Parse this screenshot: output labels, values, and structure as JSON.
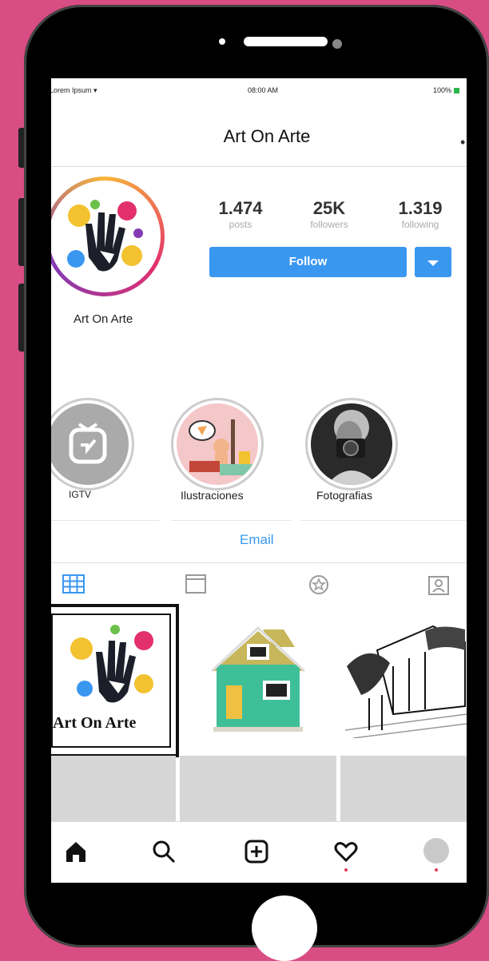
{
  "status_bar": {
    "carrier": "Lorem Ipsum",
    "time": "08:00 AM",
    "battery": "100%"
  },
  "header": {
    "title": "Art On Arte",
    "more_icon": "more-dots-icon"
  },
  "profile": {
    "name": "Art On Arte",
    "stats": [
      {
        "value": "1.474",
        "label": "posts"
      },
      {
        "value": "25K",
        "label": "followers"
      },
      {
        "value": "1.319",
        "label": "following"
      }
    ],
    "follow_label": "Follow"
  },
  "highlights": [
    {
      "label": "IGTV",
      "icon": "igtv-icon"
    },
    {
      "label": "Ilustraciones",
      "icon": "illustration-thumbnail"
    },
    {
      "label": "Fotografias",
      "icon": "photo-thumbnail"
    }
  ],
  "contact": {
    "email_label": "Email"
  },
  "tabs": [
    "grid-icon",
    "igtv-tab-icon",
    "tagged-star-icon",
    "person-tag-icon"
  ],
  "posts": [
    {
      "caption": "Art On Arte"
    },
    {
      "caption": ""
    },
    {
      "caption": ""
    }
  ],
  "bottom_nav": [
    "home-icon",
    "search-icon",
    "add-post-icon",
    "heart-icon",
    "profile-avatar-icon"
  ],
  "colors": {
    "accent": "#3a97f0",
    "background": "#d84d84",
    "notification": "#e23b5b"
  }
}
